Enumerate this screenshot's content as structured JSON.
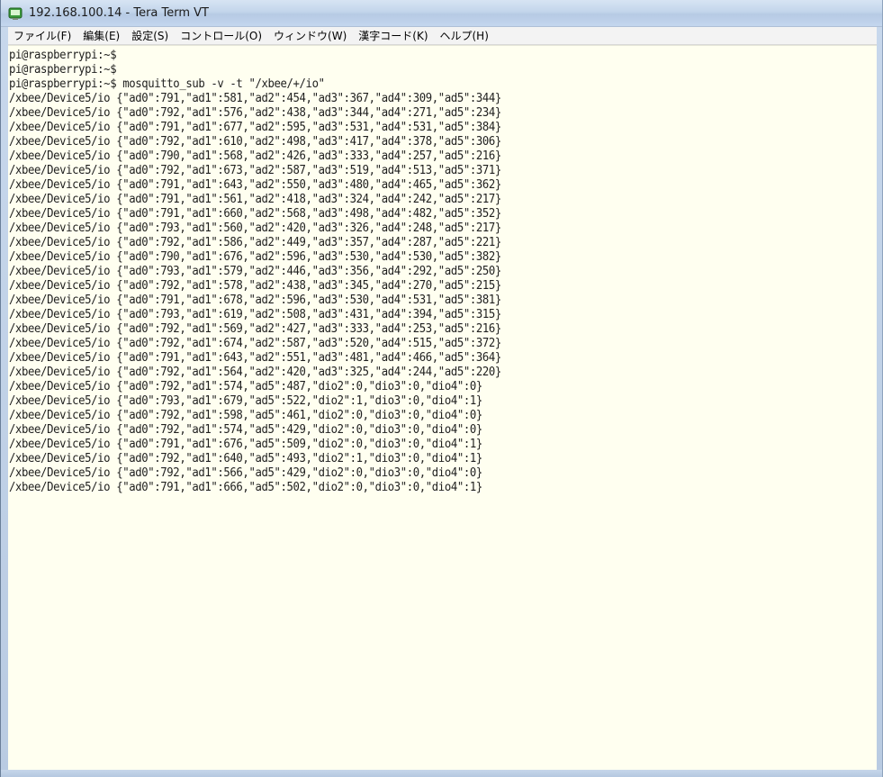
{
  "window": {
    "title": "192.168.100.14 - Tera Term VT",
    "icon": "tera-term-icon"
  },
  "menu": [
    "ファイル(F)",
    "編集(E)",
    "設定(S)",
    "コントロール(O)",
    "ウィンドウ(W)",
    "漢字コード(K)",
    "ヘルプ(H)"
  ],
  "colors": {
    "terminal_bg": "#fffff0",
    "terminal_fg": "#202020"
  },
  "terminal": {
    "lines": [
      "pi@raspberrypi:~$",
      "pi@raspberrypi:~$",
      "pi@raspberrypi:~$ mosquitto_sub -v -t \"/xbee/+/io\"",
      "/xbee/Device5/io {\"ad0\":791,\"ad1\":581,\"ad2\":454,\"ad3\":367,\"ad4\":309,\"ad5\":344}",
      "/xbee/Device5/io {\"ad0\":792,\"ad1\":576,\"ad2\":438,\"ad3\":344,\"ad4\":271,\"ad5\":234}",
      "/xbee/Device5/io {\"ad0\":791,\"ad1\":677,\"ad2\":595,\"ad3\":531,\"ad4\":531,\"ad5\":384}",
      "/xbee/Device5/io {\"ad0\":792,\"ad1\":610,\"ad2\":498,\"ad3\":417,\"ad4\":378,\"ad5\":306}",
      "/xbee/Device5/io {\"ad0\":790,\"ad1\":568,\"ad2\":426,\"ad3\":333,\"ad4\":257,\"ad5\":216}",
      "/xbee/Device5/io {\"ad0\":792,\"ad1\":673,\"ad2\":587,\"ad3\":519,\"ad4\":513,\"ad5\":371}",
      "/xbee/Device5/io {\"ad0\":791,\"ad1\":643,\"ad2\":550,\"ad3\":480,\"ad4\":465,\"ad5\":362}",
      "/xbee/Device5/io {\"ad0\":791,\"ad1\":561,\"ad2\":418,\"ad3\":324,\"ad4\":242,\"ad5\":217}",
      "/xbee/Device5/io {\"ad0\":791,\"ad1\":660,\"ad2\":568,\"ad3\":498,\"ad4\":482,\"ad5\":352}",
      "/xbee/Device5/io {\"ad0\":793,\"ad1\":560,\"ad2\":420,\"ad3\":326,\"ad4\":248,\"ad5\":217}",
      "/xbee/Device5/io {\"ad0\":792,\"ad1\":586,\"ad2\":449,\"ad3\":357,\"ad4\":287,\"ad5\":221}",
      "/xbee/Device5/io {\"ad0\":790,\"ad1\":676,\"ad2\":596,\"ad3\":530,\"ad4\":530,\"ad5\":382}",
      "/xbee/Device5/io {\"ad0\":793,\"ad1\":579,\"ad2\":446,\"ad3\":356,\"ad4\":292,\"ad5\":250}",
      "/xbee/Device5/io {\"ad0\":792,\"ad1\":578,\"ad2\":438,\"ad3\":345,\"ad4\":270,\"ad5\":215}",
      "/xbee/Device5/io {\"ad0\":791,\"ad1\":678,\"ad2\":596,\"ad3\":530,\"ad4\":531,\"ad5\":381}",
      "/xbee/Device5/io {\"ad0\":793,\"ad1\":619,\"ad2\":508,\"ad3\":431,\"ad4\":394,\"ad5\":315}",
      "/xbee/Device5/io {\"ad0\":792,\"ad1\":569,\"ad2\":427,\"ad3\":333,\"ad4\":253,\"ad5\":216}",
      "/xbee/Device5/io {\"ad0\":792,\"ad1\":674,\"ad2\":587,\"ad3\":520,\"ad4\":515,\"ad5\":372}",
      "/xbee/Device5/io {\"ad0\":791,\"ad1\":643,\"ad2\":551,\"ad3\":481,\"ad4\":466,\"ad5\":364}",
      "/xbee/Device5/io {\"ad0\":792,\"ad1\":564,\"ad2\":420,\"ad3\":325,\"ad4\":244,\"ad5\":220}",
      "/xbee/Device5/io {\"ad0\":792,\"ad1\":574,\"ad5\":487,\"dio2\":0,\"dio3\":0,\"dio4\":0}",
      "/xbee/Device5/io {\"ad0\":793,\"ad1\":679,\"ad5\":522,\"dio2\":1,\"dio3\":0,\"dio4\":1}",
      "/xbee/Device5/io {\"ad0\":792,\"ad1\":598,\"ad5\":461,\"dio2\":0,\"dio3\":0,\"dio4\":0}",
      "/xbee/Device5/io {\"ad0\":792,\"ad1\":574,\"ad5\":429,\"dio2\":0,\"dio3\":0,\"dio4\":0}",
      "/xbee/Device5/io {\"ad0\":791,\"ad1\":676,\"ad5\":509,\"dio2\":0,\"dio3\":0,\"dio4\":1}",
      "/xbee/Device5/io {\"ad0\":792,\"ad1\":640,\"ad5\":493,\"dio2\":1,\"dio3\":0,\"dio4\":1}",
      "/xbee/Device5/io {\"ad0\":792,\"ad1\":566,\"ad5\":429,\"dio2\":0,\"dio3\":0,\"dio4\":0}",
      "/xbee/Device5/io {\"ad0\":791,\"ad1\":666,\"ad5\":502,\"dio2\":0,\"dio3\":0,\"dio4\":1}"
    ]
  }
}
